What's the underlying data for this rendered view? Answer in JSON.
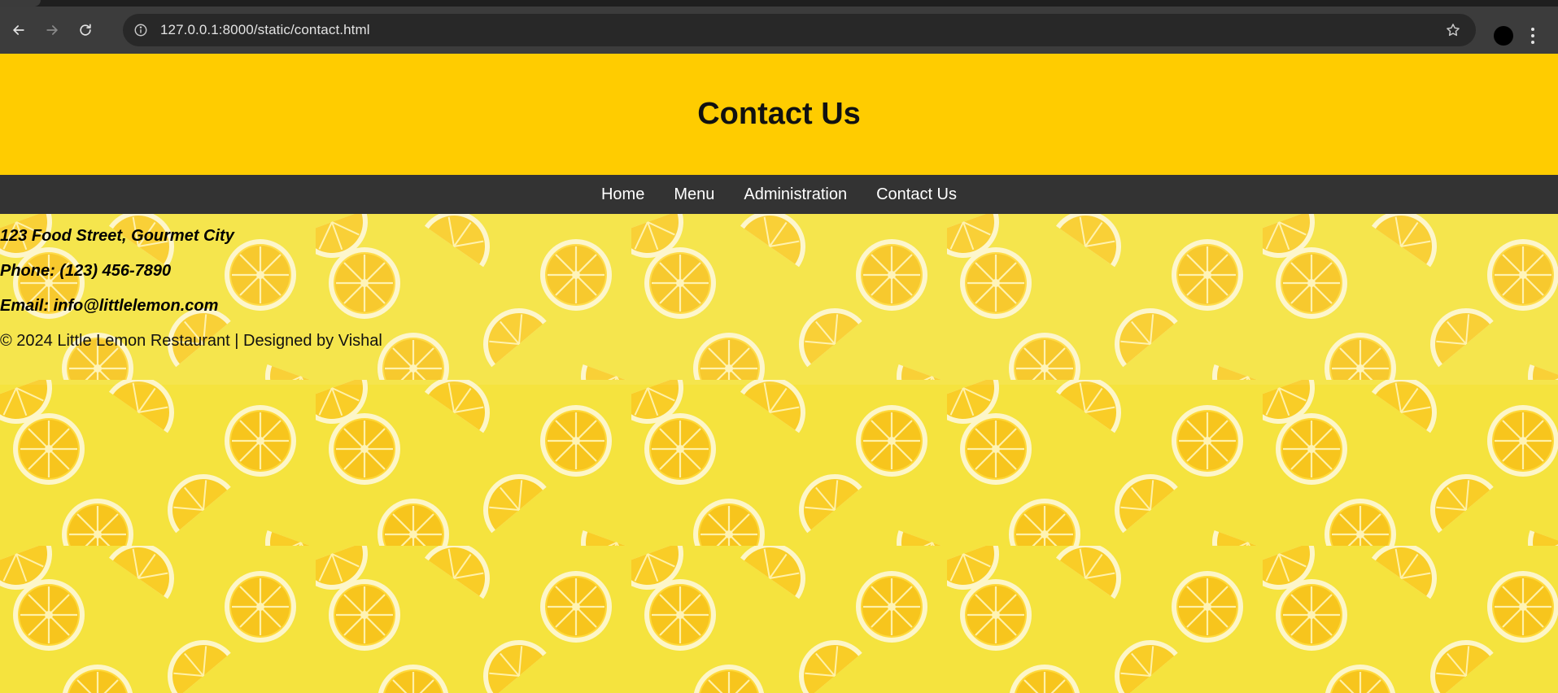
{
  "browser": {
    "url": "127.0.0.1:8000/static/contact.html",
    "icons": {
      "back": "arrow-left-icon",
      "forward": "arrow-right-icon",
      "reload": "reload-icon",
      "site_info": "info-icon",
      "bookmark": "star-icon",
      "menu": "kebab-menu-icon"
    }
  },
  "header": {
    "title": "Contact Us",
    "background": "#ffcc00"
  },
  "nav": {
    "items": [
      {
        "label": "Home"
      },
      {
        "label": "Menu"
      },
      {
        "label": "Administration"
      },
      {
        "label": "Contact Us"
      }
    ],
    "background": "#333333"
  },
  "contact": {
    "address": "123 Food Street, Gourmet City",
    "phone": "Phone: (123) 456-7890",
    "email": "Email: info@littlelemon.com"
  },
  "footer": {
    "text": "© 2024 Little Lemon Restaurant | Designed by Vishal"
  }
}
